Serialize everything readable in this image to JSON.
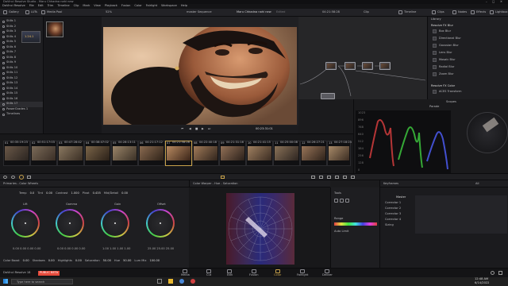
{
  "app_title": "DaVinci Resolve Studio - Maru Chhadna nahi new",
  "window_controls": {
    "min": "–",
    "max": "□",
    "close": "✕"
  },
  "menu": [
    "DaVinci Resolve",
    "File",
    "Edit",
    "Trim",
    "Timeline",
    "Clip",
    "Mark",
    "View",
    "Playback",
    "Fusion",
    "Color",
    "Fairlight",
    "Workspace",
    "Help"
  ],
  "toolbar": {
    "gallery": "Gallery",
    "luts": "LUTs",
    "media_pool": "Media Pool",
    "zoom": "52%",
    "timeline_name": "master Sequence",
    "project_title": "Maru Chhadna nahi new",
    "edited": "Edited",
    "timecode": "04:21:58:28",
    "clip": "Clip",
    "timeline": "Timeline",
    "clips_btn": "Clips",
    "nodes": "Nodes",
    "effects": "Effects",
    "lightbox": "Lightbox"
  },
  "gallery": {
    "albums": [
      "Stills 1",
      "Stills 2",
      "Stills 3",
      "Stills 4",
      "Stills 5",
      "Stills 6",
      "Stills 7",
      "Stills 8",
      "Stills 9",
      "Stills 10",
      "Stills 11",
      "Stills 12",
      "Stills 13",
      "Stills 14",
      "Stills 15",
      "Stills 16",
      "Stills 17"
    ],
    "extra": [
      "PowerGrades 1",
      "Timelines"
    ],
    "still_label": "1.24.1"
  },
  "viewer": {
    "timecode": "00:23:31:01"
  },
  "library": {
    "header": "Library",
    "section": "Resolve FX Blur",
    "items": [
      "Box Blur",
      "Directional Blur",
      "Gaussian Blur",
      "Lens Blur",
      "Mosaic Blur",
      "Radial Blur",
      "Zoom Blur"
    ],
    "section2": "Resolve FX Color",
    "items2": [
      "ACES Transform"
    ]
  },
  "scopes": {
    "title": "Scopes",
    "mode": "Parade",
    "labels": [
      "1023",
      "896",
      "768",
      "640",
      "512",
      "384",
      "256",
      "128",
      "0"
    ]
  },
  "clips": [
    {
      "n": "01",
      "tc": "00:35:19:23"
    },
    {
      "n": "02",
      "tc": "00:51:17:03"
    },
    {
      "n": "03",
      "tc": "00:47:28:42"
    },
    {
      "n": "04",
      "tc": "00:38:47:02"
    },
    {
      "n": "05",
      "tc": "04:28:13:11"
    },
    {
      "n": "06",
      "tc": "04:21:17:12"
    },
    {
      "n": "07",
      "tc": "04:21:58:28"
    },
    {
      "n": "08",
      "tc": "04:22:40:18"
    },
    {
      "n": "09",
      "tc": "04:21:31:16"
    },
    {
      "n": "10",
      "tc": "04:21:41:15"
    },
    {
      "n": "11",
      "tc": "04:25:00:08"
    },
    {
      "n": "12",
      "tc": "04:26:27:21"
    },
    {
      "n": "13",
      "tc": "04:27:18:23"
    }
  ],
  "primaries": {
    "title": "Primaries - Color Wheels",
    "temp": "Temp",
    "temp_val": "0.0",
    "tint": "Tint",
    "tint_val": "0.00",
    "contrast": "Contrast",
    "contrast_val": "1.000",
    "pivot": "Pivot",
    "pivot_val": "0.435",
    "md": "Mid/Detail",
    "md_val": "0.00",
    "wheels": [
      {
        "label": "Lift",
        "vals": "0.00  0.00  0.00  0.00"
      },
      {
        "label": "Gamma",
        "vals": "0.00  0.00  0.00  0.00"
      },
      {
        "label": "Gain",
        "vals": "1.00  1.00  1.00  1.00"
      },
      {
        "label": "Offset",
        "vals": "25.00  25.00  25.00"
      }
    ],
    "bottom": [
      "Color Boost",
      "0.00",
      "Shadows",
      "0.00",
      "Highlights",
      "0.00",
      "Saturation",
      "50.00",
      "Hue",
      "50.00",
      "Lum Mix",
      "100.00"
    ]
  },
  "hue": {
    "title": "Color Warper - Hue - Saturation",
    "tool_label": "Tools",
    "range": "Range",
    "auto": "Auto Limit"
  },
  "keyframes": {
    "title": "Keyframes",
    "filter": "All",
    "master": "Master",
    "rows": [
      "Corrector 1",
      "Corrector 2",
      "Corrector 3",
      "Corrector 4",
      "Sizing"
    ]
  },
  "pages": [
    "Media",
    "Cut",
    "Edit",
    "Fusion",
    "Color",
    "Fairlight",
    "Deliver"
  ],
  "footer": {
    "app": "DaVinci Resolve 18",
    "beta": "PUBLIC BETA"
  },
  "taskbar": {
    "search": "Type here to search",
    "time": "12:48 AM",
    "date": "6/14/2022"
  },
  "colors": {
    "accent": "#e64b3c",
    "panel": "#1e1e21",
    "active_page": "#c8a24a"
  }
}
